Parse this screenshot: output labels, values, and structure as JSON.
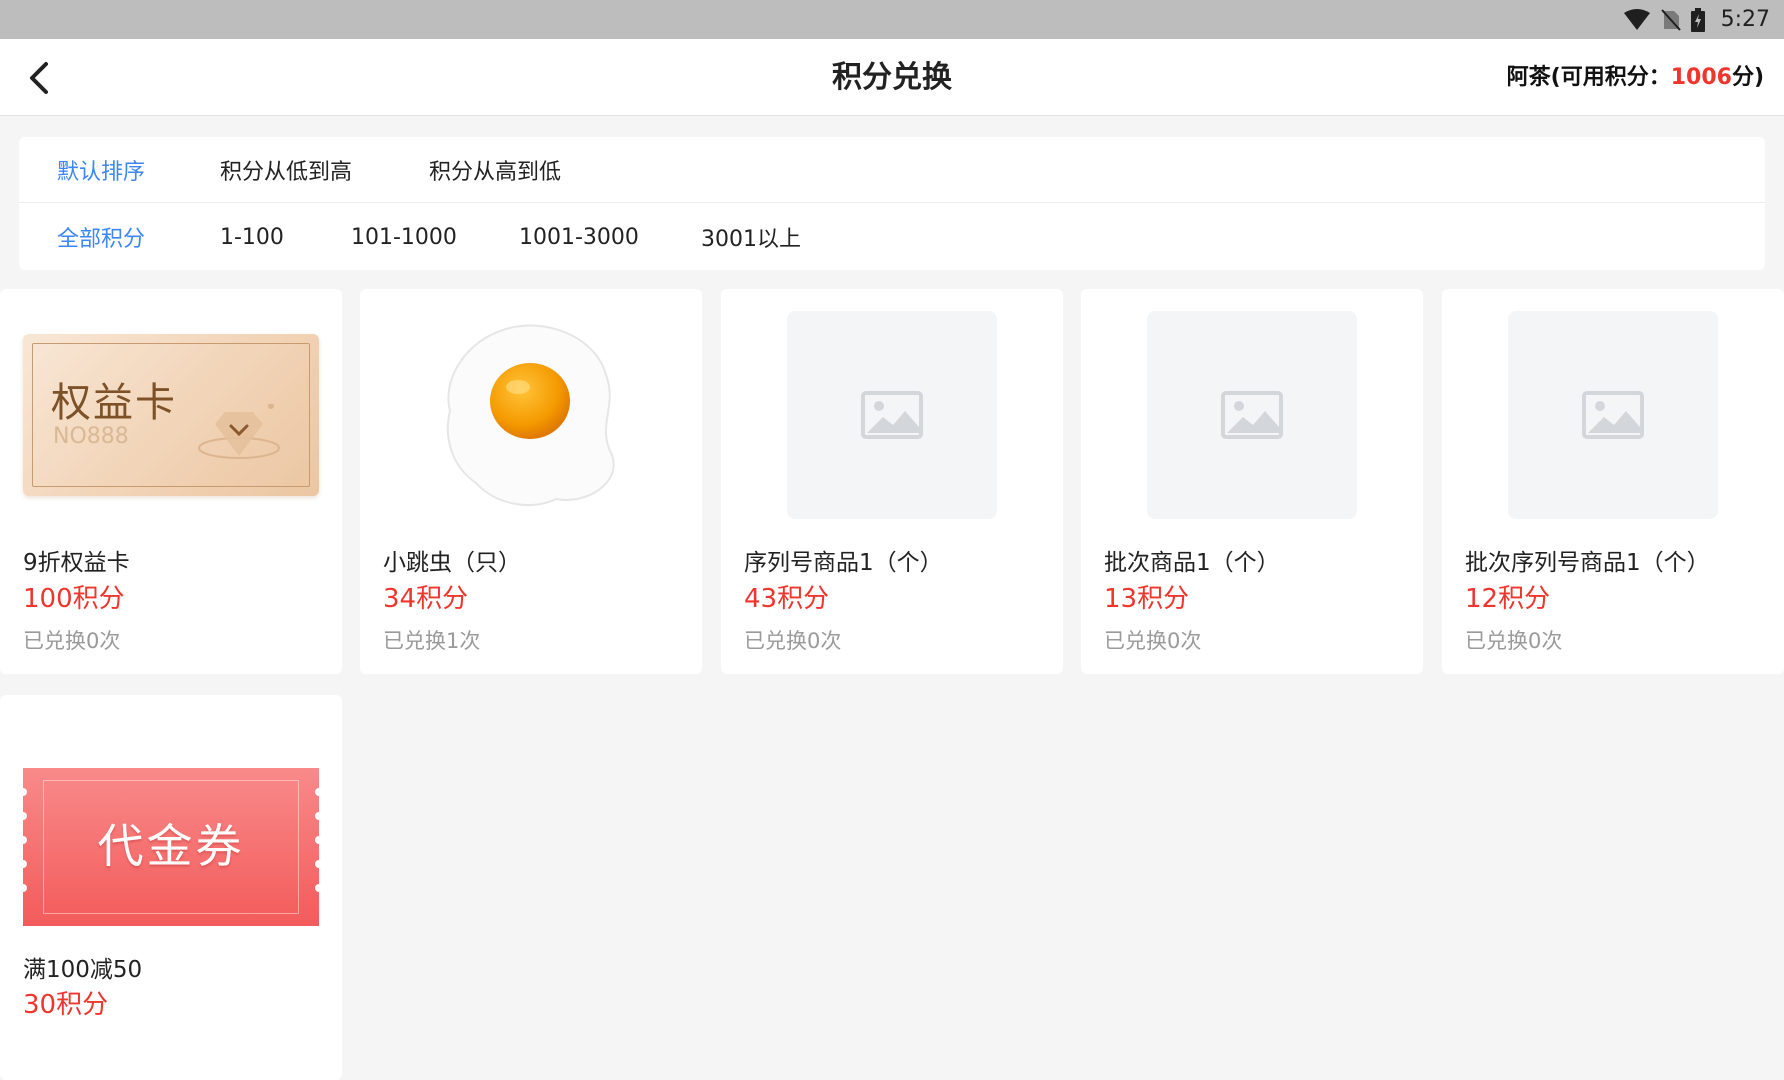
{
  "status_bar": {
    "time": "5:27"
  },
  "header": {
    "title": "积分兑换",
    "user_prefix": "阿茶(可用积分：",
    "points": "1006",
    "user_suffix": "分)"
  },
  "sort_options": [
    {
      "label": "默认排序",
      "active": true
    },
    {
      "label": "积分从低到高",
      "active": false
    },
    {
      "label": "积分从高到低",
      "active": false
    }
  ],
  "range_options": [
    {
      "label": "全部积分",
      "active": true
    },
    {
      "label": "1-100",
      "active": false
    },
    {
      "label": "101-1000",
      "active": false
    },
    {
      "label": "1001-3000",
      "active": false
    },
    {
      "label": "3001以上",
      "active": false
    }
  ],
  "products": [
    {
      "name": "9折权益卡",
      "price": "100积分",
      "redeemed": "已兑换0次",
      "image": "benefit-card",
      "card_title": "权益卡",
      "card_no": "NO888"
    },
    {
      "name": "小跳虫（只）",
      "price": "34积分",
      "redeemed": "已兑换1次",
      "image": "fried-egg"
    },
    {
      "name": "序列号商品1（个）",
      "price": "43积分",
      "redeemed": "已兑换0次",
      "image": "placeholder"
    },
    {
      "name": "批次商品1（个）",
      "price": "13积分",
      "redeemed": "已兑换0次",
      "image": "placeholder"
    },
    {
      "name": "批次序列号商品1（个）",
      "price": "12积分",
      "redeemed": "已兑换0次",
      "image": "placeholder"
    },
    {
      "name": "满100减50",
      "price": "30积分",
      "redeemed": "",
      "image": "voucher",
      "voucher_title": "代金券"
    }
  ],
  "colors": {
    "accent_blue": "#3d86f5",
    "price_red": "#f0352d",
    "muted_gray": "#9a9a9a"
  }
}
